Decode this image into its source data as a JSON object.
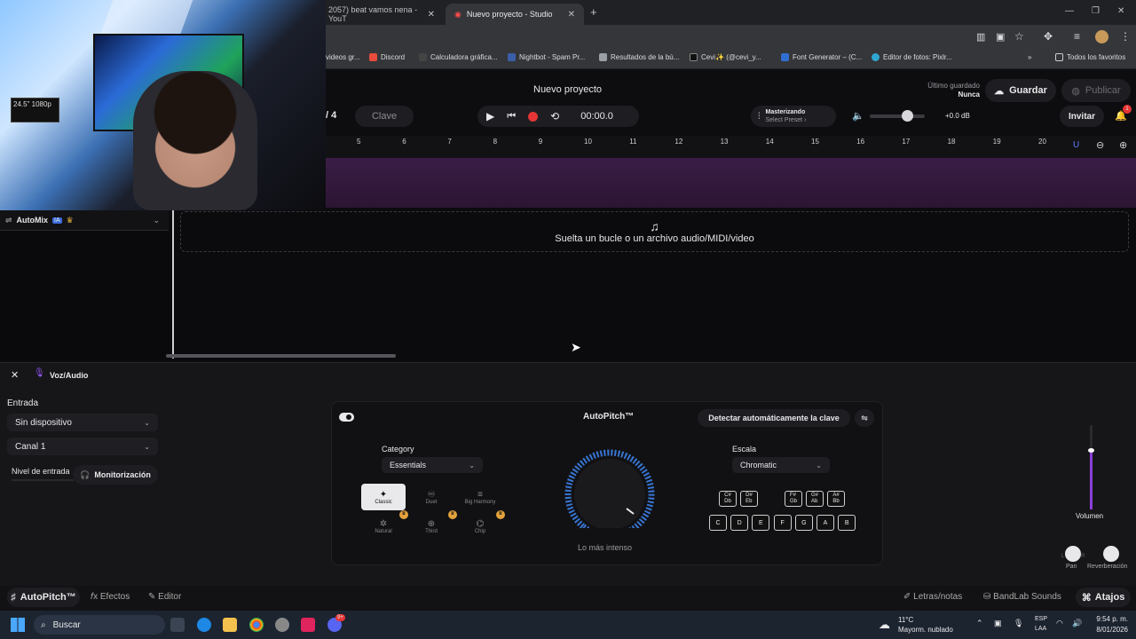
{
  "browser": {
    "tabs": [
      {
        "label": "2057) beat vamos nena - YouT"
      },
      {
        "label": "Nuevo proyecto - Studio"
      }
    ],
    "bookmarks": [
      {
        "label": "videos gr..."
      },
      {
        "label": "Discord"
      },
      {
        "label": "Calculadora gráfica..."
      },
      {
        "label": "Nightbot - Spam Pr..."
      },
      {
        "label": "Resultados de la bú..."
      },
      {
        "label": "Cevi✨ (@cevi_y..."
      },
      {
        "label": "Font Generator – (C..."
      },
      {
        "label": "Editor de fotos: Pixlr..."
      },
      {
        "label": "Todos los favoritos"
      }
    ]
  },
  "header": {
    "project_title": "Nuevo proyecto",
    "time_sig": "/ 4",
    "key_label": "Clave",
    "time": "00:00.0",
    "mastering_title": "Masterizando",
    "mastering_sub": "Select Preset ›",
    "db": "+0.0 dB",
    "saved_label": "Último guardado",
    "saved_value": "Nunca",
    "save_btn": "Guardar",
    "publish_btn": "Publicar",
    "invite_btn": "Invitar",
    "notif_count": "1"
  },
  "ruler": {
    "marks": [
      "5",
      "6",
      "7",
      "8",
      "9",
      "10",
      "11",
      "12",
      "13",
      "14",
      "15",
      "16",
      "17",
      "18",
      "19",
      "20"
    ]
  },
  "automix": {
    "label": "AutoMix",
    "badge": "IA"
  },
  "droparea": {
    "text": "Suelta un bucle o un archivo audio/MIDI/video"
  },
  "panel": {
    "track_name": "Voz/Audio",
    "input_label": "Entrada",
    "device": "Sin dispositivo",
    "channel": "Canal 1",
    "level_label": "Nivel de entrada",
    "monitor_btn": "Monitorización",
    "volume_label": "Volumen",
    "pan_label": "Pan",
    "reverb_label": "Reverberación",
    "pan_l": "L",
    "pan_r": "R"
  },
  "autopitch": {
    "title": "AutoPitch™",
    "detect_btn": "Detectar automáticamente la clave",
    "category_label": "Category",
    "category_value": "Essentials",
    "scale_label": "Escala",
    "scale_value": "Chromatic",
    "knob_label": "Lo más intenso",
    "presets": [
      "Classic",
      "Duet",
      "Big Harmony",
      "Natural",
      "Third",
      "Chip"
    ],
    "black_keys": [
      [
        "C#",
        "Db"
      ],
      [
        "D#",
        "Eb"
      ],
      [
        "F#",
        "Gb"
      ],
      [
        "G#",
        "Ab"
      ],
      [
        "A#",
        "Bb"
      ]
    ],
    "white_keys": [
      "C",
      "D",
      "E",
      "F",
      "G",
      "A",
      "B"
    ]
  },
  "bottombar": {
    "autopitch_tab": "AutoPitch™",
    "effects_tab": "Efectos",
    "editor_tab": "Editor",
    "lyrics": "Letras/notas",
    "sounds": "BandLab Sounds",
    "shortcuts": "Atajos"
  },
  "taskbar": {
    "search": "Buscar",
    "temp": "11°C",
    "weather": "Mayorm. nublado",
    "lang1": "ESP",
    "lang2": "LAA",
    "time": "9:54 p. m.",
    "date": "8/01/2026",
    "badge": "9+"
  },
  "webcam": {
    "overlay": "24.5\" 1080p"
  }
}
